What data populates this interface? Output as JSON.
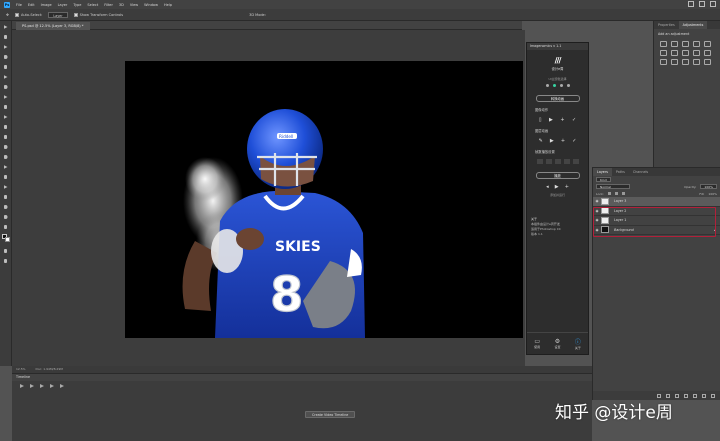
{
  "app": {
    "logo": "Ps",
    "menus": [
      "File",
      "Edit",
      "Image",
      "Layer",
      "Type",
      "Select",
      "Filter",
      "3D",
      "View",
      "Window",
      "Help"
    ]
  },
  "options_bar": {
    "auto_select_label": "Auto-Select:",
    "auto_select_value": "Layer",
    "show_transform_label": "Show Transform Controls",
    "mode_label": "3D Mode:"
  },
  "document": {
    "tab_title": "PS.psd @ 12.5% (Layer 3, RGB/8) *",
    "jersey_text": "SKIES",
    "jersey_number": "8",
    "helmet_text": "Riddell"
  },
  "status": {
    "zoom": "12.5%",
    "doc_size": "Doc: 1.94M/8.29M"
  },
  "timeline": {
    "panel_title": "Timeline",
    "create_button": "Create Video Timeline"
  },
  "plugin": {
    "title": "Imagenomics v 1.1",
    "brand": "设计e周",
    "subtitle": "UI主题色选择",
    "primary_button": "转换动画",
    "label_one": "图像动作",
    "label_two": "图层动画",
    "label_three": "帧数播放设置",
    "secondary_button": "播放",
    "hint": "添加并运行",
    "about_title": "关于",
    "about_lines": [
      "本插件由设计e周开发",
      "适用于Photoshop CC",
      "版本 1.1"
    ],
    "footer": [
      {
        "icon": "monitor-icon",
        "label": "使用"
      },
      {
        "icon": "gear-icon",
        "label": "设置"
      },
      {
        "icon": "info-icon",
        "label": "关于"
      }
    ]
  },
  "right_panel": {
    "tabs": [
      "Properties",
      "Adjustments"
    ],
    "active_tab": "Adjustments",
    "heading": "Add an adjustment"
  },
  "layers_panel": {
    "tabs": [
      "Layers",
      "Paths",
      "Channels"
    ],
    "kind_label": "Kind",
    "blend_mode": "Normal",
    "opacity_label": "Opacity:",
    "opacity_value": "100%",
    "lock_label": "Lock:",
    "fill_label": "Fill:",
    "fill_value": "100%",
    "layers": [
      {
        "name": "Layer 3",
        "selected": true
      },
      {
        "name": "Layer 2",
        "selected": false
      },
      {
        "name": "Layer 1",
        "selected": false
      },
      {
        "name": "Background",
        "selected": false
      }
    ]
  },
  "watermark": "知乎 @设计e周",
  "colors": {
    "highlight": "#b2203a",
    "helmet": "#1f4fd8",
    "jersey": "#1c3fb0"
  }
}
